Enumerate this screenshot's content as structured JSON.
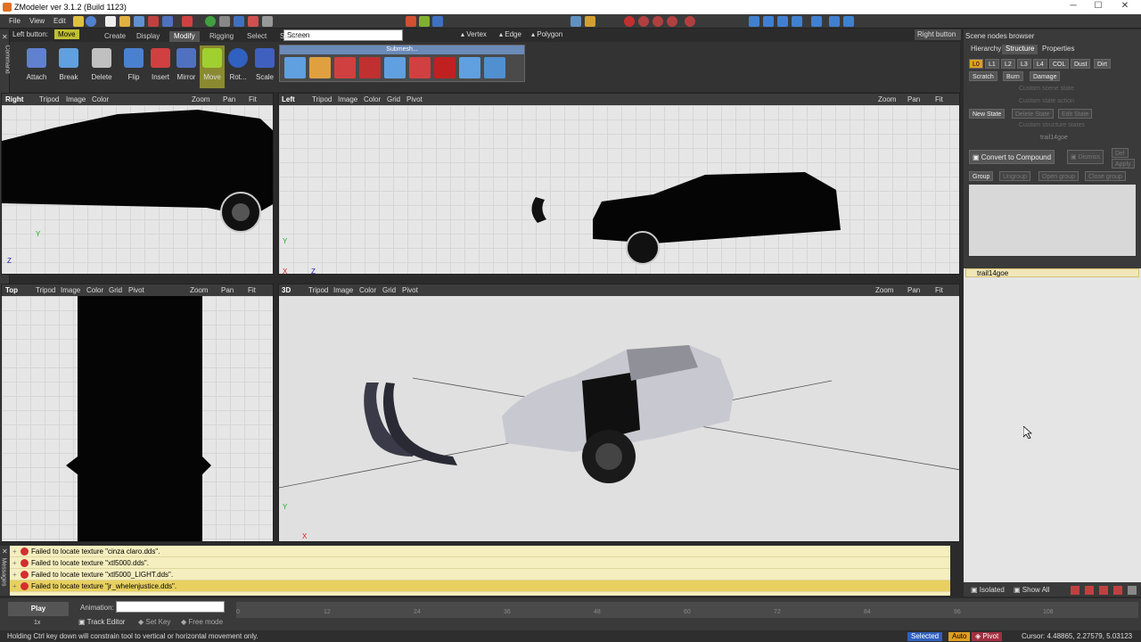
{
  "window": {
    "title": "ZModeler ver 3.1.2 (Build 1123)",
    "minimize": "─",
    "maximize": "☐",
    "close": "✕"
  },
  "menu": [
    "File",
    "View",
    "Edit"
  ],
  "toolbar": {
    "screen_select": "Screen",
    "vertex_label": "Vertex",
    "edge_label": "Edge",
    "polygon_label": "Polygon"
  },
  "left_button": {
    "label": "Left button:",
    "value": "Move"
  },
  "tabs": [
    "Create",
    "Display",
    "Modify",
    "Rigging",
    "Select",
    "Surface"
  ],
  "ribbon": {
    "buttons": [
      "Attach",
      "Break",
      "Delete",
      "Flip",
      "Insert",
      "Mirror",
      "Move",
      "Rot...",
      "Scale"
    ],
    "submesh_label": "Submesh..."
  },
  "right_button": "Right button",
  "sidebar": {
    "command_label": "Command",
    "messages_label": "Messages"
  },
  "viewports": [
    {
      "name": "Right",
      "items": [
        "Tripod",
        "Image",
        "Color"
      ],
      "tools": [
        "Zoom",
        "Pan",
        "Fit"
      ],
      "axis_v": "Y",
      "axis_h": "Z"
    },
    {
      "name": "Left",
      "items": [
        "Tripod",
        "Image",
        "Color",
        "Grid",
        "Pivot"
      ],
      "tools": [
        "Zoom",
        "Pan",
        "Fit"
      ],
      "axis_v": "Y",
      "axis_h": "X",
      "axis_h2": "Z"
    },
    {
      "name": "Top",
      "items": [
        "Tripod",
        "Image",
        "Color",
        "Grid",
        "Pivot"
      ],
      "tools": [
        "Zoom",
        "Pan",
        "Fit"
      ]
    },
    {
      "name": "3D",
      "items": [
        "Tripod",
        "Image",
        "Color",
        "Grid",
        "Pivot"
      ],
      "tools": [
        "Zoom",
        "Pan",
        "Fit"
      ],
      "axis_v": "Y",
      "axis_h": "X"
    }
  ],
  "right_panel": {
    "title": "Scene nodes browser",
    "tabs": [
      "Hierarchy",
      "Structure",
      "Properties"
    ],
    "lod_buttons": [
      "L0",
      "L1",
      "L2",
      "L3",
      "L4",
      "COL",
      "Dust",
      "Dirt"
    ],
    "state_buttons": [
      "Scratch",
      "Burn",
      "Damage"
    ],
    "dim_labels": [
      "Custom scene state",
      "Custom state action",
      "Custom structure states"
    ],
    "new_state": "New State",
    "delete_state": "Delete State",
    "edit_state": "Edit State",
    "node_name": "trail14goe",
    "convert": "Convert to Compound",
    "dismiss": "Dismiss",
    "del": "Del",
    "apply": "Apply",
    "group": "Group",
    "ungroup": "Ungroup",
    "open_group": "Open group",
    "close_group": "Close group",
    "hierarchy_item": "trail14goe",
    "bottom_isolated": "Isolated",
    "bottom_showall": "Show All"
  },
  "messages": [
    "Failed to locate texture \"cinza claro.dds\".",
    "Failed to locate texture \"xtl5000.dds\".",
    "Failed to locate texture \"xtl5000_LIGHT.dds\".",
    "Failed to locate texture \"jr_whelenjustice.dds\"."
  ],
  "timeline": {
    "play": "Play",
    "speed": "1x",
    "animation_label": "Animation:",
    "track_editor": "Track Editor",
    "set_key": "Set Key",
    "free_mode": "Free mode",
    "ticks": [
      "0",
      "12",
      "24",
      "36",
      "48",
      "60",
      "72",
      "84",
      "96",
      "108"
    ]
  },
  "status": {
    "hint": "Holding Ctrl key down will constrain tool to vertical or horizontal movement only.",
    "selected": "Selected",
    "auto": "Auto",
    "pivot": "Pivot",
    "cursor": "Cursor: 4.48865, 2.27579, 5.03123"
  }
}
